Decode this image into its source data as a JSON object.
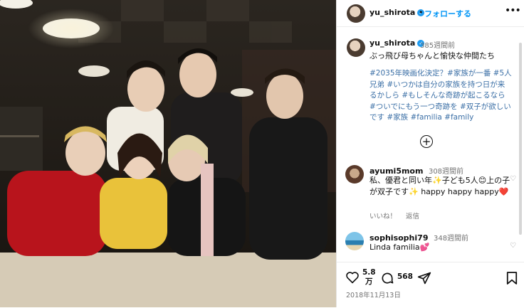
{
  "post": {
    "username": "yu_shirota",
    "verified_mark": "✓",
    "dot": "•",
    "follow_label": "フォローする",
    "more_icon": "•••"
  },
  "caption": {
    "username": "yu_shirota",
    "age": "385週間前",
    "line1": "ぶっ飛び母ちゃんと愉快な仲間たち",
    "hashtags": "#2035年映画化決定？#家族が一番 #5人兄弟 #いつかは自分の家族を持つ日が来るかしら #もしそんな奇跡が起こるなら #ついでにもう一つ奇跡を #双子が欲しいです #家族 #familia #family",
    "load_more_icon": "+"
  },
  "comments": [
    {
      "username": "ayumi5mom",
      "age": "308週間前",
      "text": "私、優君と同い年✨子ども5人😊上の子が双子です✨ happy happy happy❤️",
      "like_label": "いいね！",
      "reply_label": "返信"
    },
    {
      "username": "sophisophi79",
      "age": "348週間前",
      "text": "Linda familia💕"
    }
  ],
  "actions": {
    "like_count_line1": "5.8",
    "like_count_line2": "万",
    "comment_count": "568",
    "date": "2018年11月13日"
  },
  "colors": {
    "link": "#0095f6",
    "hashtag": "#3b6fa6",
    "muted": "#737373",
    "verified": "#1d9bf0"
  },
  "icons": [
    "heart-icon",
    "comment-icon",
    "share-icon",
    "bookmark-icon",
    "verified-icon",
    "more-icon",
    "plus-circle-icon"
  ]
}
